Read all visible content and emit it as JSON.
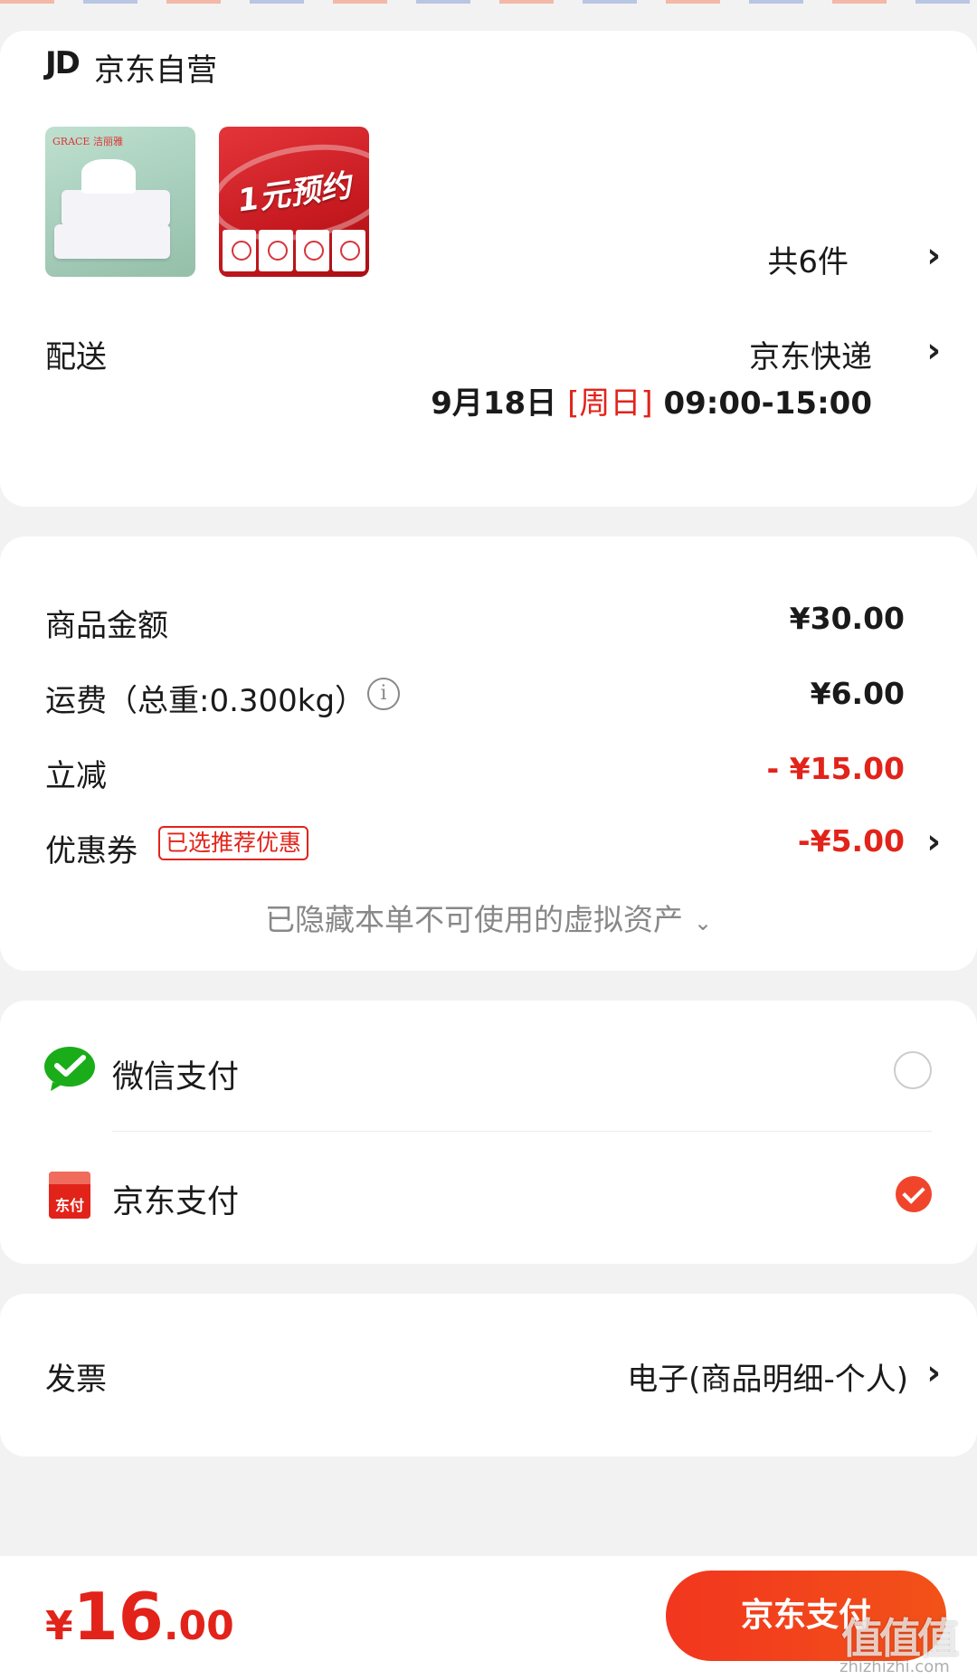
{
  "shop": {
    "logo_text": "JD",
    "name": "京东自营",
    "products": [
      {
        "brand": "GRACE 洁丽雅"
      },
      {
        "promo_text": "1元预约"
      }
    ],
    "count": "共6件"
  },
  "delivery": {
    "label": "配送",
    "method": "京东快递",
    "date": "9月18日",
    "weekday": "[周日]",
    "window": "09:00-15:00"
  },
  "price": {
    "goods_label": "商品金额",
    "goods_amount": "¥30.00",
    "shipping_label": "运费（总重:0.300kg）",
    "info_icon": "i",
    "shipping_amount": "¥6.00",
    "discount_label": "立减",
    "discount_amount": "- ¥15.00",
    "coupon_label": "优惠券",
    "coupon_tag": "已选推荐优惠",
    "coupon_amount": "-¥5.00",
    "hidden_assets": "已隐藏本单不可使用的虚拟资产",
    "hidden_caret": "⌄"
  },
  "payment": {
    "options": [
      {
        "label": "微信支付",
        "icon": "wechat-pay-icon",
        "selected": false
      },
      {
        "label": "京东支付",
        "icon": "jd-pay-icon",
        "icon_text": "东付",
        "selected": true
      }
    ]
  },
  "invoice": {
    "label": "发票",
    "value": "电子(商品明细-个人)"
  },
  "footer": {
    "total_symbol": "¥",
    "total_int": "16",
    "total_dec": ".00",
    "pay_button": "京东支付"
  },
  "watermark": {
    "main": "值值值",
    "sub": "zhizhizhi.com"
  },
  "colors": {
    "accent": "#e2231a",
    "button": "#f2361f",
    "background": "#f2f2f2"
  }
}
